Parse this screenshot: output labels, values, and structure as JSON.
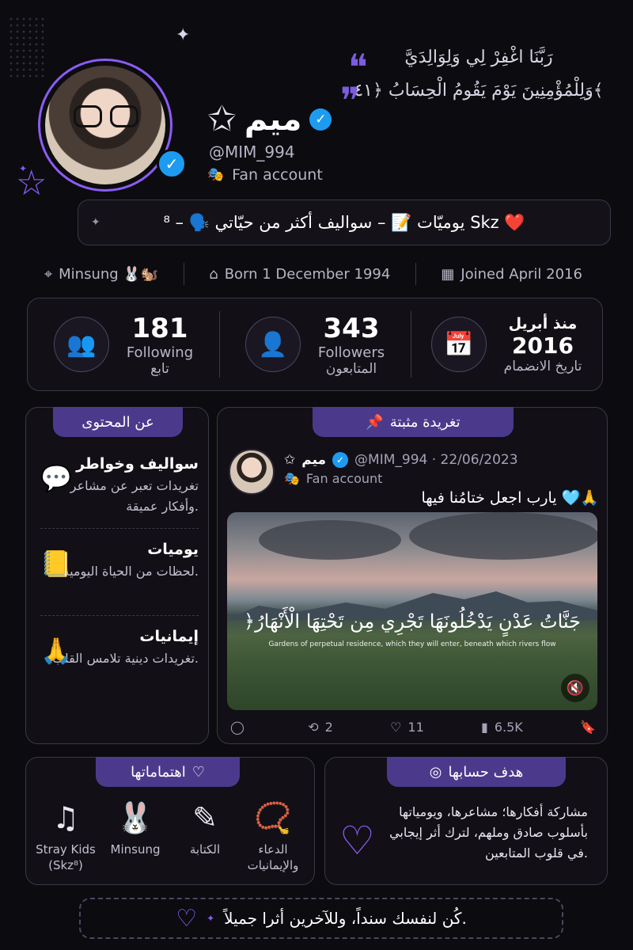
{
  "profile": {
    "name": "ميم",
    "handle": "@MIM_994",
    "fan_label": "Fan account",
    "verified_icon": "check-icon"
  },
  "quote": {
    "line1": "رَبَّنَا اغْفِرْ لِي وَلِوَالِدَيَّ",
    "line2": "وَلِلْمُؤْمِنِينَ يَوْمَ يَقُومُ الْحِسَابُ ﴿٤١﴾"
  },
  "bio": {
    "text": "يوميّات 📝 – سواليف أكثر من حيّاتي 🗣️ – ⁸ Skz ❤️"
  },
  "meta": {
    "location": "Minsung 🐰🐿️",
    "born": "Born 1 December 1994",
    "joined": "Joined April 2016"
  },
  "stats": {
    "following_count": "181",
    "following_label": "Following",
    "following_ar": "تابع",
    "followers_count": "343",
    "followers_label": "Followers",
    "followers_ar": "المتابعون",
    "join_since": "منذ أبريل",
    "join_year": "2016",
    "join_label": "تاريخ الانضمام"
  },
  "about": {
    "title": "عن المحتوى",
    "items": [
      {
        "title": "سواليف وخواطر",
        "desc": "تغريدات تعبر عن مشاعر وأفكار عميقة."
      },
      {
        "title": "يوميات",
        "desc": "لحظات من الحياة اليومية."
      },
      {
        "title": "إيمانيات",
        "desc": "تغريدات دينية تلامس القلب."
      }
    ]
  },
  "pinned": {
    "title": "تغريدة مثبتة",
    "name": "ميم",
    "handle_date": "@MIM_994 · 22/06/2023",
    "fan_label": "Fan account",
    "text": "يارب اجعل ختامُنا فيها 🩵🙏",
    "verse": "﴿جَنَّاتُ عَدْنٍ يَدْخُلُونَهَا تَجْرِي مِن تَحْتِهَا الْأَنْهَارُ",
    "verse_en": "Gardens of perpetual residence, which they will enter, beneath which rivers flow",
    "replies": "",
    "retweets": "2",
    "likes": "11",
    "views": "6.5K"
  },
  "interests": {
    "title": "اهتماماتها",
    "items": [
      {
        "label": "الدعاء والإيمانيات",
        "icon": "prayer-beads-icon"
      },
      {
        "label": "الكتابة",
        "icon": "pen-icon"
      },
      {
        "label": "Minsung",
        "icon": "rabbit-icon"
      },
      {
        "label": "Stray Kids (Skz⁸)",
        "icon": "music-note-icon"
      }
    ]
  },
  "goal": {
    "title": "هدف حسابها",
    "text": "مشاركة أفكارها؛ مشاعرها، ويومياتها بأسلوب صادق وملهم، لترك أثر إيجابي في قلوب المتابعين."
  },
  "footer": {
    "text": "كُن لنفسك سنداً، وللآخرين أثرا جميلاً."
  },
  "colors": {
    "accent": "#8b5cf6",
    "tab": "#4b3a8c",
    "verified": "#1d9bf0",
    "background": "#0c0b0f"
  }
}
